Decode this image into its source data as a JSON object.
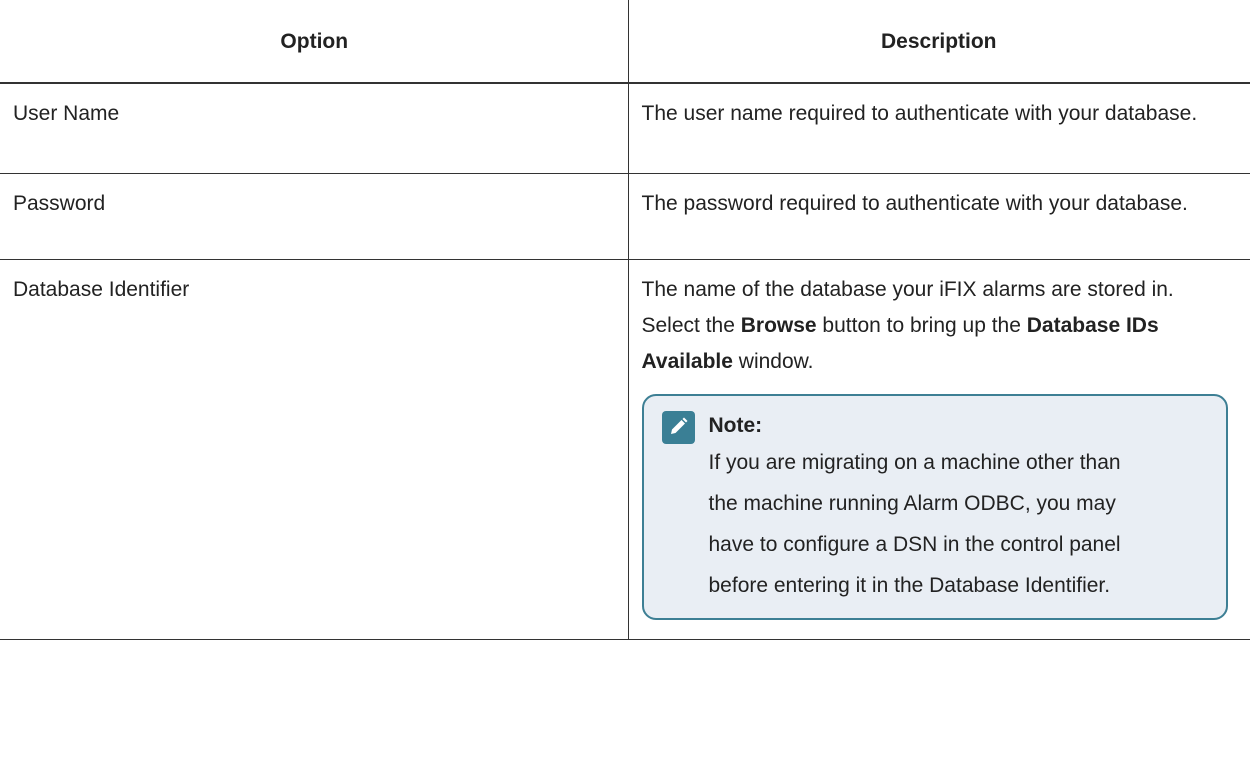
{
  "table": {
    "headers": {
      "option": "Option",
      "description": "Description"
    },
    "rows": [
      {
        "option": "User Name",
        "description": "The user name required to authenticate with your database."
      },
      {
        "option": "Password",
        "description": "The password required to authenticate with your database."
      },
      {
        "option": "Database Identifier",
        "description_part1": "The name of the database your iFIX alarms are stored in. Select the ",
        "description_bold1": "Browse",
        "description_part2": " button to bring up the ",
        "description_bold2": "Database IDs Available",
        "description_part3": " window."
      }
    ]
  },
  "note": {
    "icon": "pencil-icon",
    "title": "Note:",
    "text": "If you are migrating on a machine other than the machine running Alarm ODBC, you may have to configure a DSN in the control panel before entering it in the Database Identifier.",
    "colors": {
      "border": "#3d7f94",
      "background": "#e9eef4",
      "icon_bg": "#3a7f95"
    }
  }
}
